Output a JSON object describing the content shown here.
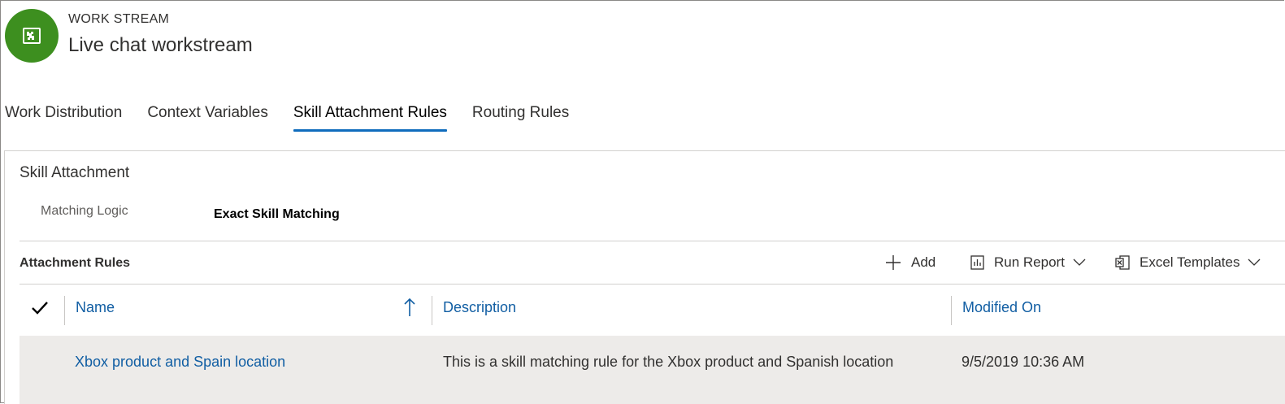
{
  "header": {
    "entity_type": "WORK STREAM",
    "title": "Live chat workstream",
    "icon": "workstream-icon",
    "icon_color": "#3d8f1f"
  },
  "tabs": [
    {
      "label": "Work Distribution",
      "active": false
    },
    {
      "label": "Context Variables",
      "active": false
    },
    {
      "label": "Skill Attachment Rules",
      "active": true
    },
    {
      "label": "Routing Rules",
      "active": false
    }
  ],
  "section": {
    "title": "Skill Attachment",
    "field_label": "Matching Logic",
    "field_value": "Exact Skill Matching"
  },
  "subgrid": {
    "title": "Attachment Rules",
    "commands": {
      "add": "Add",
      "run_report": "Run Report",
      "excel_templates": "Excel Templates"
    },
    "columns": {
      "name": "Name",
      "description": "Description",
      "modified_on": "Modified On"
    },
    "sort": {
      "column": "Name",
      "direction": "ascending"
    },
    "rows": [
      {
        "name": "Xbox product and Spain location",
        "description": "This is a skill matching rule for the Xbox product and Spanish location",
        "modified_on": "9/5/2019 10:36 AM"
      }
    ]
  },
  "colors": {
    "accent": "#0f6cbd",
    "link": "#115ea3",
    "row_highlight": "#edebe9"
  }
}
